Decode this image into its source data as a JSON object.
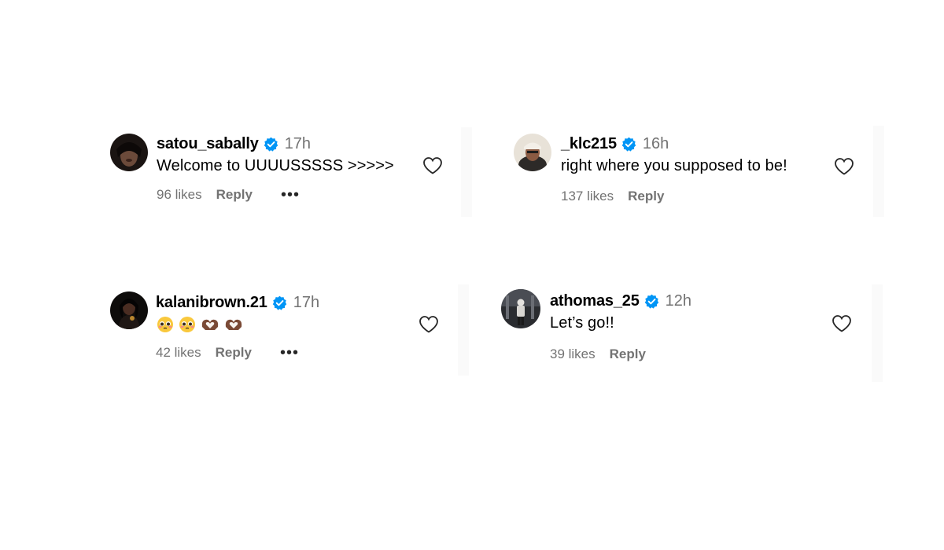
{
  "comments": [
    {
      "username": "satou_sabally",
      "time": "17h",
      "text": "Welcome to UUUUSSSSS >>>>>",
      "likes": "96 likes",
      "reply": "Reply",
      "more_icon": "more-dots-icon"
    },
    {
      "username": "_klc215",
      "time": "16h",
      "text": "right where you supposed to be!",
      "likes": "137 likes",
      "reply": "Reply"
    },
    {
      "username": "kalanibrown.21",
      "time": "17h",
      "text": "",
      "emojis": [
        "pleading-face-icon",
        "pleading-face-icon",
        "heart-hands-icon",
        "heart-hands-icon"
      ],
      "likes": "42 likes",
      "reply": "Reply",
      "more_icon": "more-dots-icon"
    },
    {
      "username": "athomas_25",
      "time": "12h",
      "text": "Let’s go!!",
      "likes": "39 likes",
      "reply": "Reply"
    }
  ],
  "colors": {
    "verified": "#0095f6",
    "muted_text": "#737373",
    "background": "#ffffff"
  }
}
